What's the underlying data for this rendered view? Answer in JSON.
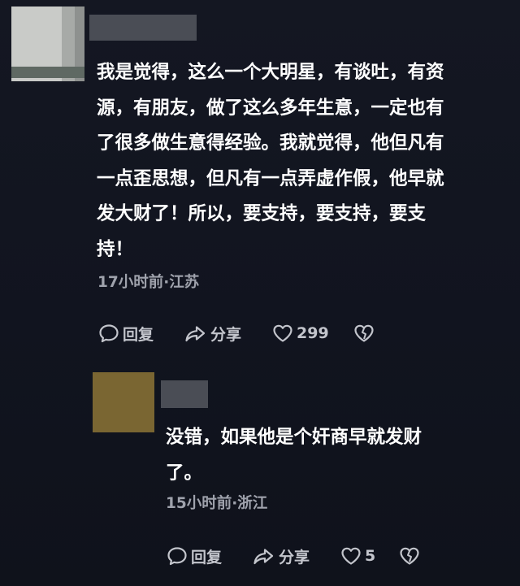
{
  "comments": [
    {
      "body": "我是觉得，这么一个大明星，有谈吐，有资\n源，有朋友，做了这么多年生意，一定也有\n了很多做生意得经验。我就觉得，他但凡有\n一点歪思想，但凡有一点弄虚作假，他早就\n发大财了！所以，要支持，要支持，要支\n持！",
      "meta": "17小时前·江苏",
      "actions": {
        "reply": "回复",
        "share": "分享",
        "likes": "299"
      },
      "icons": {
        "reply": "speech-bubble-icon",
        "share": "share-arrow-icon",
        "like": "heart-icon",
        "dislike": "broken-heart-icon"
      }
    },
    {
      "body": "没错，如果他是个奸商早就发财\n了。",
      "meta": "15小时前·浙江",
      "actions": {
        "reply": "回复",
        "share": "分享",
        "likes": "5"
      },
      "icons": {
        "reply": "speech-bubble-icon",
        "share": "share-arrow-icon",
        "like": "heart-icon",
        "dislike": "broken-heart-icon"
      }
    }
  ],
  "colors": {
    "background": "#141722",
    "text": "#ffffff",
    "meta_text": "#9fa2ac",
    "action_text": "#c3c5cc",
    "username_redacted": "#4a4d55"
  }
}
